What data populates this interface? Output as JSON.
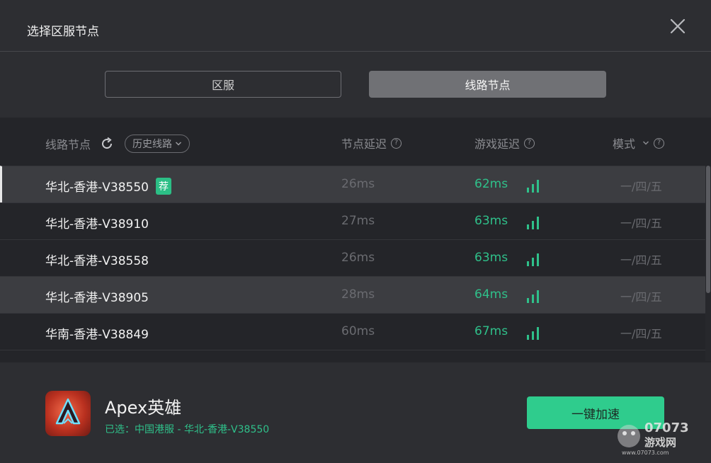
{
  "dialog": {
    "title": "选择区服节点"
  },
  "tabs": [
    {
      "label": "区服",
      "active": false
    },
    {
      "label": "线路节点",
      "active": true
    }
  ],
  "table": {
    "headers": {
      "route": "线路节点",
      "history": "历史线路",
      "node_latency": "节点延迟",
      "game_latency": "游戏延迟",
      "mode": "模式"
    },
    "rows": [
      {
        "name": "华北-香港-V38550",
        "badge": "荐",
        "node_latency": "26ms",
        "game_latency": "62ms",
        "mode": "一/四/五"
      },
      {
        "name": "华北-香港-V38910",
        "node_latency": "27ms",
        "game_latency": "63ms",
        "mode": "一/四/五"
      },
      {
        "name": "华北-香港-V38558",
        "node_latency": "26ms",
        "game_latency": "63ms",
        "mode": "一/四/五"
      },
      {
        "name": "华北-香港-V38905",
        "node_latency": "28ms",
        "game_latency": "64ms",
        "mode": "一/四/五"
      },
      {
        "name": "华南-香港-V38849",
        "node_latency": "60ms",
        "game_latency": "67ms",
        "mode": "一/四/五"
      }
    ]
  },
  "footer": {
    "app_name": "Apex英雄",
    "selected_text": "已选：中国港服 - 华北-香港-V38550",
    "accelerate_label": "一键加速"
  },
  "watermark": {
    "top": "07073",
    "bottom": "游戏网",
    "url": "www.07073.com"
  },
  "colors": {
    "accent": "#2fcc8d",
    "latency_green": "#2fc08a",
    "background": "#2d2e32"
  }
}
